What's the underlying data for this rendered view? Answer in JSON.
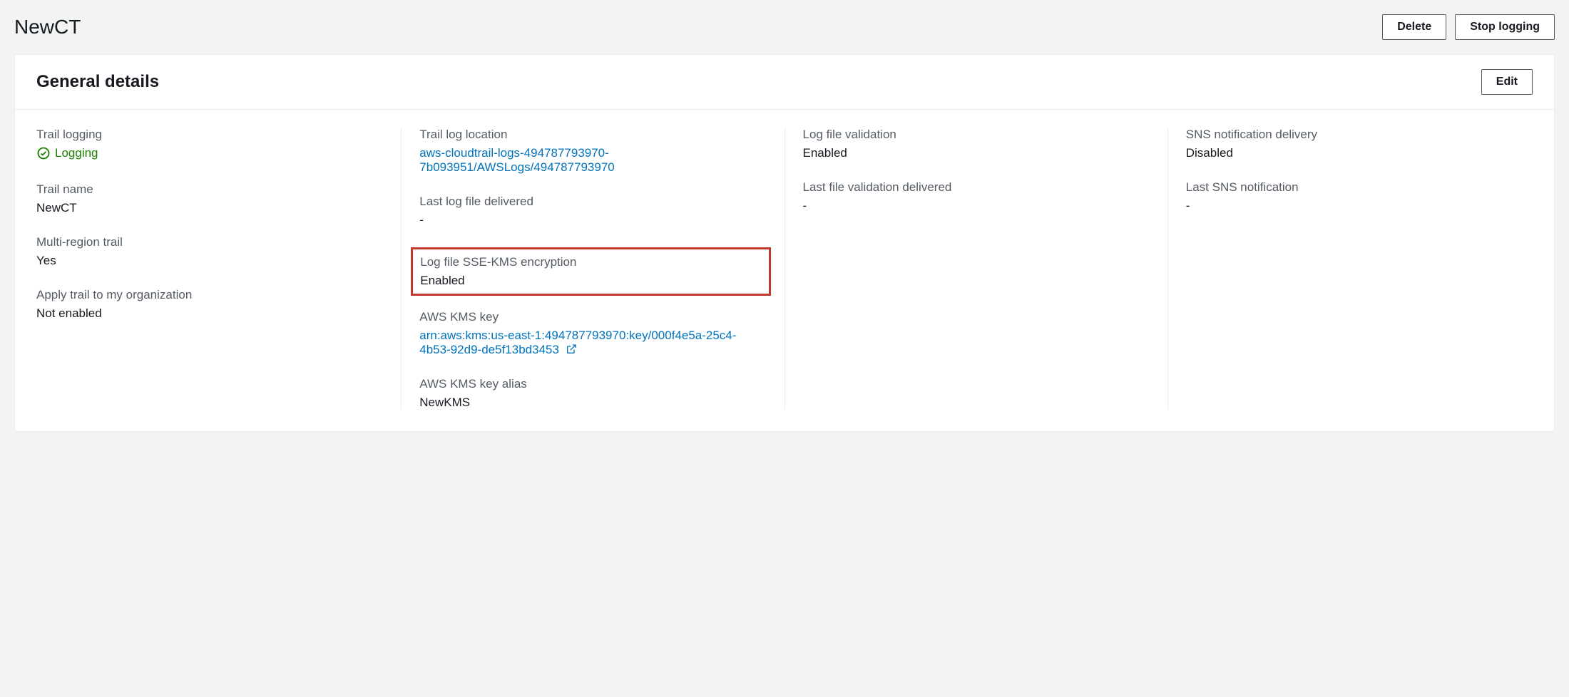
{
  "header": {
    "title": "NewCT",
    "actions": {
      "delete": "Delete",
      "stop_logging": "Stop logging"
    }
  },
  "panel": {
    "title": "General details",
    "edit": "Edit"
  },
  "col1": {
    "trail_logging": {
      "label": "Trail logging",
      "value": "Logging"
    },
    "trail_name": {
      "label": "Trail name",
      "value": "NewCT"
    },
    "multi_region": {
      "label": "Multi-region trail",
      "value": "Yes"
    },
    "apply_org": {
      "label": "Apply trail to my organization",
      "value": "Not enabled"
    }
  },
  "col2": {
    "log_location": {
      "label": "Trail log location",
      "value": "aws-cloudtrail-logs-494787793970-7b093951/AWSLogs/494787793970"
    },
    "last_log": {
      "label": "Last log file delivered",
      "value": "-"
    },
    "sse_kms": {
      "label": "Log file SSE-KMS encryption",
      "value": "Enabled"
    },
    "kms_key": {
      "label": "AWS KMS key",
      "value": "arn:aws:kms:us-east-1:494787793970:key/000f4e5a-25c4-4b53-92d9-de5f13bd3453"
    },
    "kms_alias": {
      "label": "AWS KMS key alias",
      "value": "NewKMS"
    }
  },
  "col3": {
    "validation": {
      "label": "Log file validation",
      "value": "Enabled"
    },
    "last_validation": {
      "label": "Last file validation delivered",
      "value": "-"
    }
  },
  "col4": {
    "sns": {
      "label": "SNS notification delivery",
      "value": "Disabled"
    },
    "last_sns": {
      "label": "Last SNS notification",
      "value": "-"
    }
  }
}
